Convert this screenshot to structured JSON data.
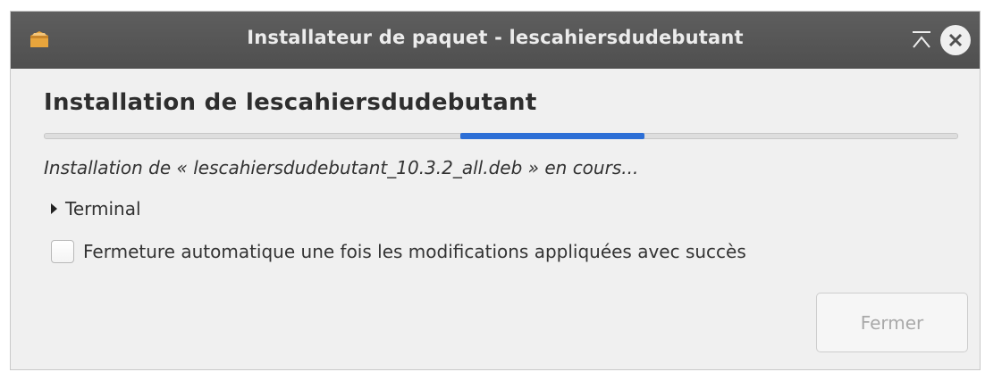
{
  "window": {
    "title": "Installateur de paquet - lescahiersdudebutant",
    "app_icon": "package-icon",
    "minimize_icon": "minimize-icon",
    "close_icon": "close-icon"
  },
  "content": {
    "heading": "Installation de lescahiersdudebutant",
    "progress_state": "indeterminate",
    "status_text": "Installation de « lescahiersdudebutant_10.3.2_all.deb » en cours...",
    "expander_label": "Terminal",
    "expander_expanded": false,
    "auto_close_label": "Fermeture automatique une fois les modifications appliquées avec succès",
    "auto_close_checked": false,
    "close_button_label": "Fermer",
    "close_button_enabled": false
  },
  "colors": {
    "titlebar": "#555555",
    "progress_accent": "#2d6fd6",
    "background": "#f0f0f0"
  }
}
